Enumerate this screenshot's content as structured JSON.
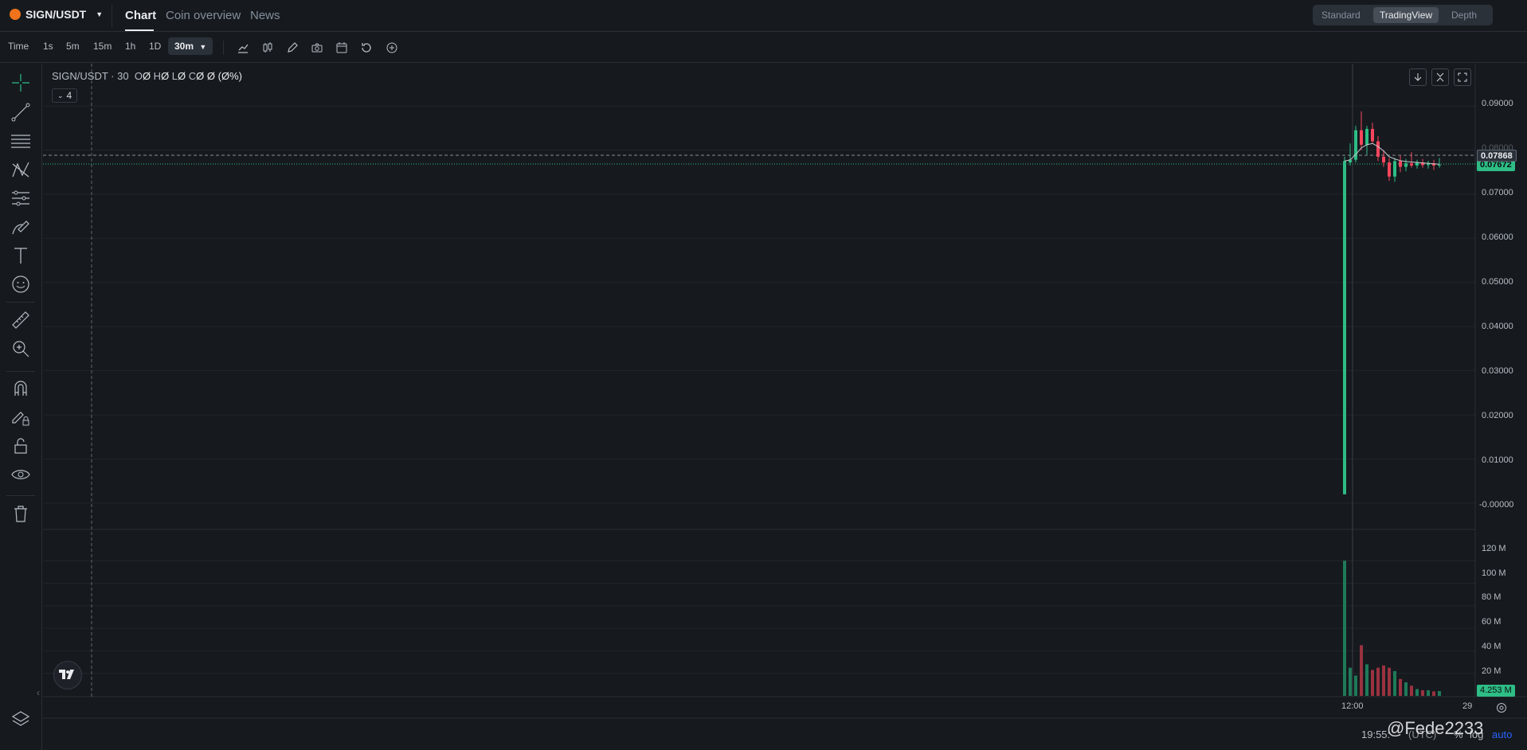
{
  "header": {
    "pair": "SIGN/USDT",
    "tabs": [
      "Chart",
      "Coin overview",
      "News"
    ],
    "views": [
      "Standard",
      "TradingView",
      "Depth"
    ],
    "active_view": "TradingView"
  },
  "toolbar": {
    "time_label": "Time",
    "intervals": [
      "1s",
      "5m",
      "15m",
      "1h",
      "1D"
    ],
    "active_interval": "30m"
  },
  "legend": {
    "symbol": "SIGN/USDT",
    "interval": "30",
    "o": "Ø",
    "h": "Ø",
    "l": "Ø",
    "c": "Ø",
    "change": "Ø (Ø%)",
    "collapse_count": "4"
  },
  "price_axis": [
    "0.09000",
    "0.08000",
    "0.07000",
    "0.06000",
    "0.05000",
    "0.04000",
    "0.03000",
    "0.02000",
    "0.01000",
    "-0.00000"
  ],
  "price_badges": {
    "crosshair": "0.07868",
    "last": "0.07672"
  },
  "volume_axis": [
    "120 M",
    "100 M",
    "80 M",
    "60 M",
    "40 M",
    "20 M"
  ],
  "volume_badge": "4.253 M",
  "time_axis": [
    "12:00",
    "29"
  ],
  "status": {
    "clock": "19:55:",
    "tz": "(UTC)",
    "pct": "%",
    "log": "log",
    "auto": "auto"
  },
  "watermark": "@Fede2233",
  "colors": {
    "up": "#2ebd85",
    "down": "#f6465d",
    "bg": "#161a1e"
  },
  "chart_data": {
    "type": "candlestick",
    "ylim": [
      -0.002,
      0.092
    ],
    "candles": [
      {
        "o": 0.002,
        "h": 0.0785,
        "l": 0.002,
        "c": 0.0775,
        "v": 120
      },
      {
        "o": 0.0772,
        "h": 0.0815,
        "l": 0.0765,
        "c": 0.0778,
        "v": 25
      },
      {
        "o": 0.0778,
        "h": 0.0855,
        "l": 0.0772,
        "c": 0.0845,
        "v": 18
      },
      {
        "o": 0.0845,
        "h": 0.0888,
        "l": 0.08,
        "c": 0.0812,
        "v": 45
      },
      {
        "o": 0.0812,
        "h": 0.0855,
        "l": 0.079,
        "c": 0.0848,
        "v": 28
      },
      {
        "o": 0.0848,
        "h": 0.0862,
        "l": 0.0815,
        "c": 0.082,
        "v": 23
      },
      {
        "o": 0.082,
        "h": 0.0832,
        "l": 0.0775,
        "c": 0.0785,
        "v": 25
      },
      {
        "o": 0.0785,
        "h": 0.08,
        "l": 0.0762,
        "c": 0.0772,
        "v": 27
      },
      {
        "o": 0.0772,
        "h": 0.0782,
        "l": 0.073,
        "c": 0.074,
        "v": 25
      },
      {
        "o": 0.074,
        "h": 0.0782,
        "l": 0.0728,
        "c": 0.0775,
        "v": 22
      },
      {
        "o": 0.0775,
        "h": 0.0788,
        "l": 0.075,
        "c": 0.0762,
        "v": 15
      },
      {
        "o": 0.0762,
        "h": 0.078,
        "l": 0.0752,
        "c": 0.077,
        "v": 12
      },
      {
        "o": 0.077,
        "h": 0.0795,
        "l": 0.076,
        "c": 0.0765,
        "v": 9
      },
      {
        "o": 0.0765,
        "h": 0.0778,
        "l": 0.0758,
        "c": 0.0772,
        "v": 6
      },
      {
        "o": 0.0772,
        "h": 0.078,
        "l": 0.076,
        "c": 0.0766,
        "v": 5
      },
      {
        "o": 0.0766,
        "h": 0.0776,
        "l": 0.0758,
        "c": 0.077,
        "v": 5
      },
      {
        "o": 0.077,
        "h": 0.0778,
        "l": 0.0755,
        "c": 0.0765,
        "v": 4
      },
      {
        "o": 0.0765,
        "h": 0.0782,
        "l": 0.076,
        "c": 0.0767,
        "v": 4.253
      }
    ],
    "ma": [
      0.0775,
      0.0778,
      0.079,
      0.0805,
      0.0812,
      0.0815,
      0.0808,
      0.0798,
      0.0785,
      0.078,
      0.0776,
      0.0774,
      0.0773,
      0.0772,
      0.0771,
      0.077,
      0.0769,
      0.0768
    ],
    "volume_ylim": [
      0,
      140
    ]
  }
}
